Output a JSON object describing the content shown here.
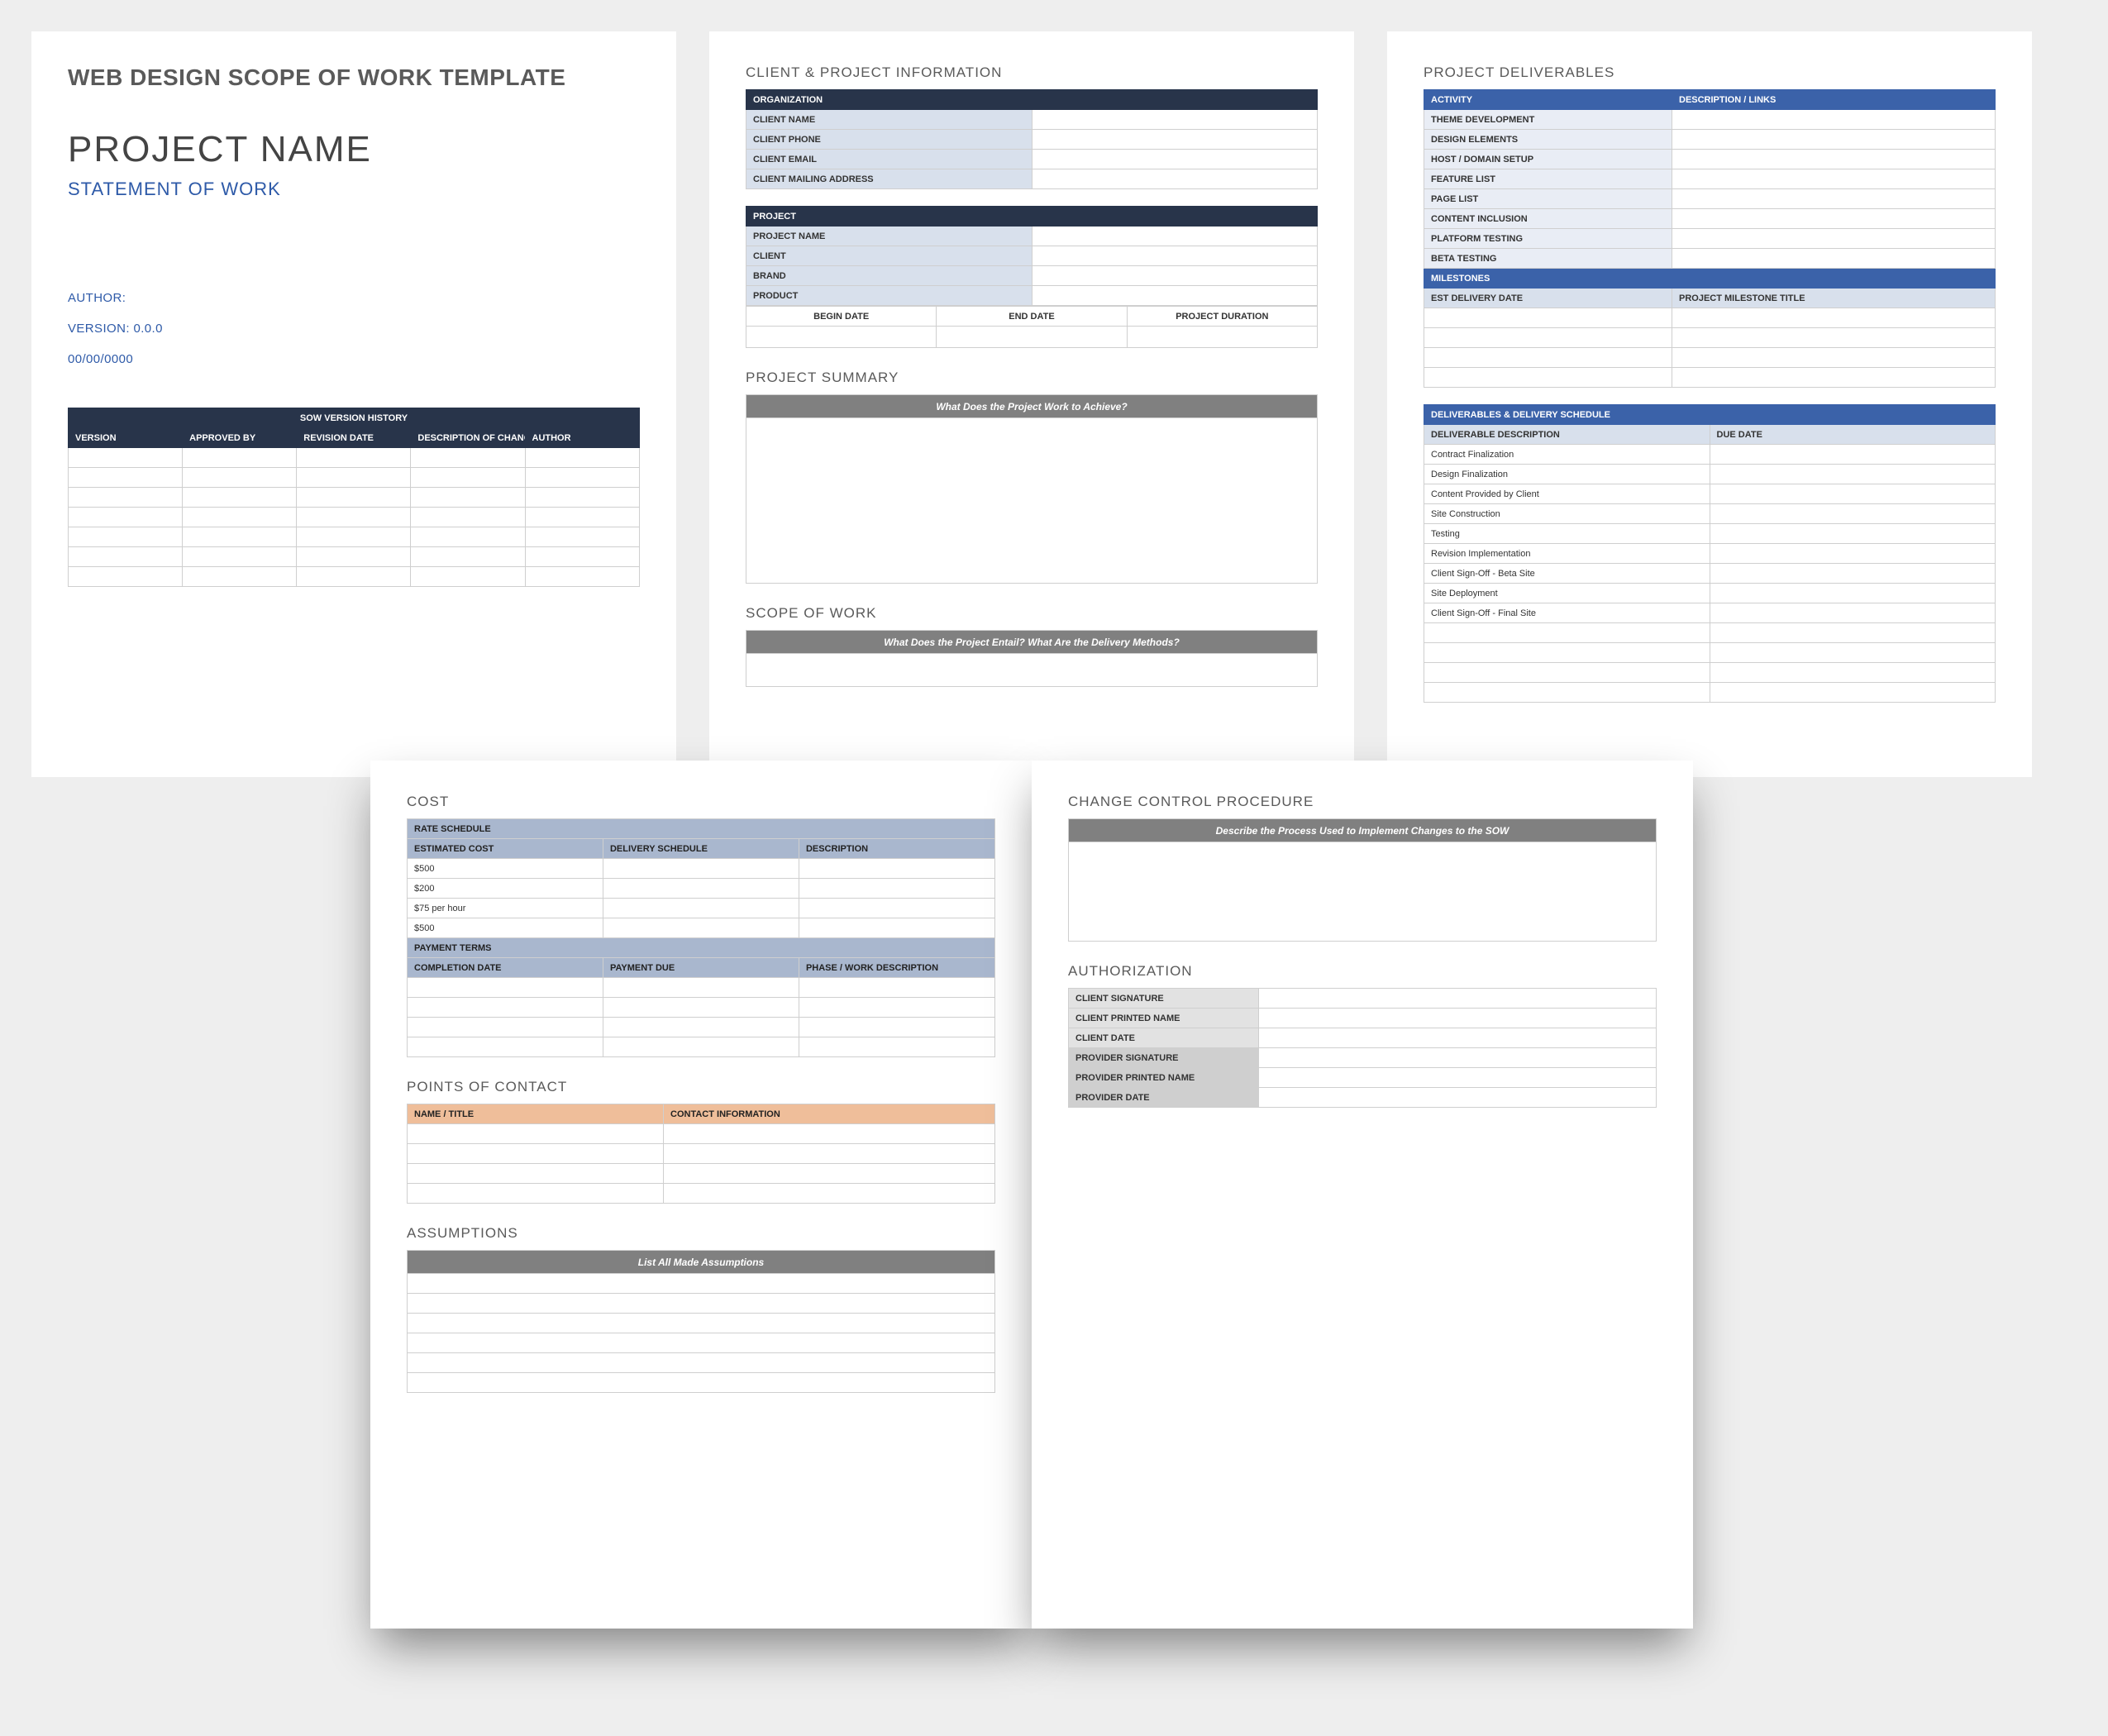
{
  "page1": {
    "template_title": "WEB DESIGN SCOPE OF WORK TEMPLATE",
    "project_name": "PROJECT NAME",
    "subtitle": "STATEMENT OF WORK",
    "author_label": "AUTHOR:",
    "version_label": "VERSION: 0.0.0",
    "date_label": "00/00/0000",
    "version_history": {
      "title": "SOW VERSION HISTORY",
      "headers": [
        "VERSION",
        "APPROVED BY",
        "REVISION DATE",
        "DESCRIPTION OF CHANGE",
        "AUTHOR"
      ]
    }
  },
  "page2": {
    "sect_client": "CLIENT & PROJECT INFORMATION",
    "org_header": "ORGANIZATION",
    "org_rows": [
      "CLIENT NAME",
      "CLIENT  PHONE",
      "CLIENT EMAIL",
      "CLIENT MAILING ADDRESS"
    ],
    "proj_header": "PROJECT",
    "proj_rows": [
      "PROJECT NAME",
      "CLIENT",
      "BRAND",
      "PRODUCT"
    ],
    "date_headers": [
      "BEGIN DATE",
      "END DATE",
      "PROJECT DURATION"
    ],
    "sect_summary": "PROJECT SUMMARY",
    "summary_prompt": "What Does the Project Work to Achieve?",
    "sect_scope": "SCOPE OF WORK",
    "scope_prompt": "What Does the Project Entail? What Are the Delivery Methods?"
  },
  "page3": {
    "sect_deliv": "PROJECT DELIVERABLES",
    "act_headers": [
      "ACTIVITY",
      "DESCRIPTION / LINKS"
    ],
    "activities": [
      "THEME DEVELOPMENT",
      "DESIGN ELEMENTS",
      "HOST / DOMAIN SETUP",
      "FEATURE LIST",
      "PAGE LIST",
      "CONTENT INCLUSION",
      "PLATFORM TESTING",
      "BETA TESTING"
    ],
    "mil_header": "MILESTONES",
    "mil_cols": [
      "EST DELIVERY DATE",
      "PROJECT MILESTONE TITLE"
    ],
    "sched_header": "DELIVERABLES & DELIVERY SCHEDULE",
    "sched_cols": [
      "DELIVERABLE DESCRIPTION",
      "DUE DATE"
    ],
    "sched_rows": [
      "Contract Finalization",
      "Design Finalization",
      "Content Provided by Client",
      "Site Construction",
      "Testing",
      "Revision Implementation",
      "Client Sign-Off - Beta Site",
      "Site Deployment",
      "Client Sign-Off - Final Site"
    ]
  },
  "page4": {
    "sect_cost": "COST",
    "rate_header": "RATE SCHEDULE",
    "rate_cols": [
      "ESTIMATED COST",
      "DELIVERY SCHEDULE",
      "DESCRIPTION"
    ],
    "rate_rows": [
      "$500",
      "$200",
      "$75 per hour",
      "$500"
    ],
    "pay_header": "PAYMENT TERMS",
    "pay_cols": [
      "COMPLETION DATE",
      "PAYMENT DUE",
      "PHASE / WORK DESCRIPTION"
    ],
    "sect_poc": "POINTS OF CONTACT",
    "poc_cols": [
      "NAME / TITLE",
      "CONTACT INFORMATION"
    ],
    "sect_assump": "ASSUMPTIONS",
    "assump_prompt": "List All Made Assumptions"
  },
  "page5": {
    "sect_change": "CHANGE CONTROL PROCEDURE",
    "change_prompt": "Describe the Process Used to Implement Changes to the SOW",
    "sect_auth": "AUTHORIZATION",
    "auth_rows_client": [
      "CLIENT SIGNATURE",
      "CLIENT PRINTED NAME",
      "CLIENT DATE"
    ],
    "auth_rows_provider": [
      "PROVIDER SIGNATURE",
      "PROVIDER PRINTED NAME",
      "PROVIDER DATE"
    ]
  }
}
